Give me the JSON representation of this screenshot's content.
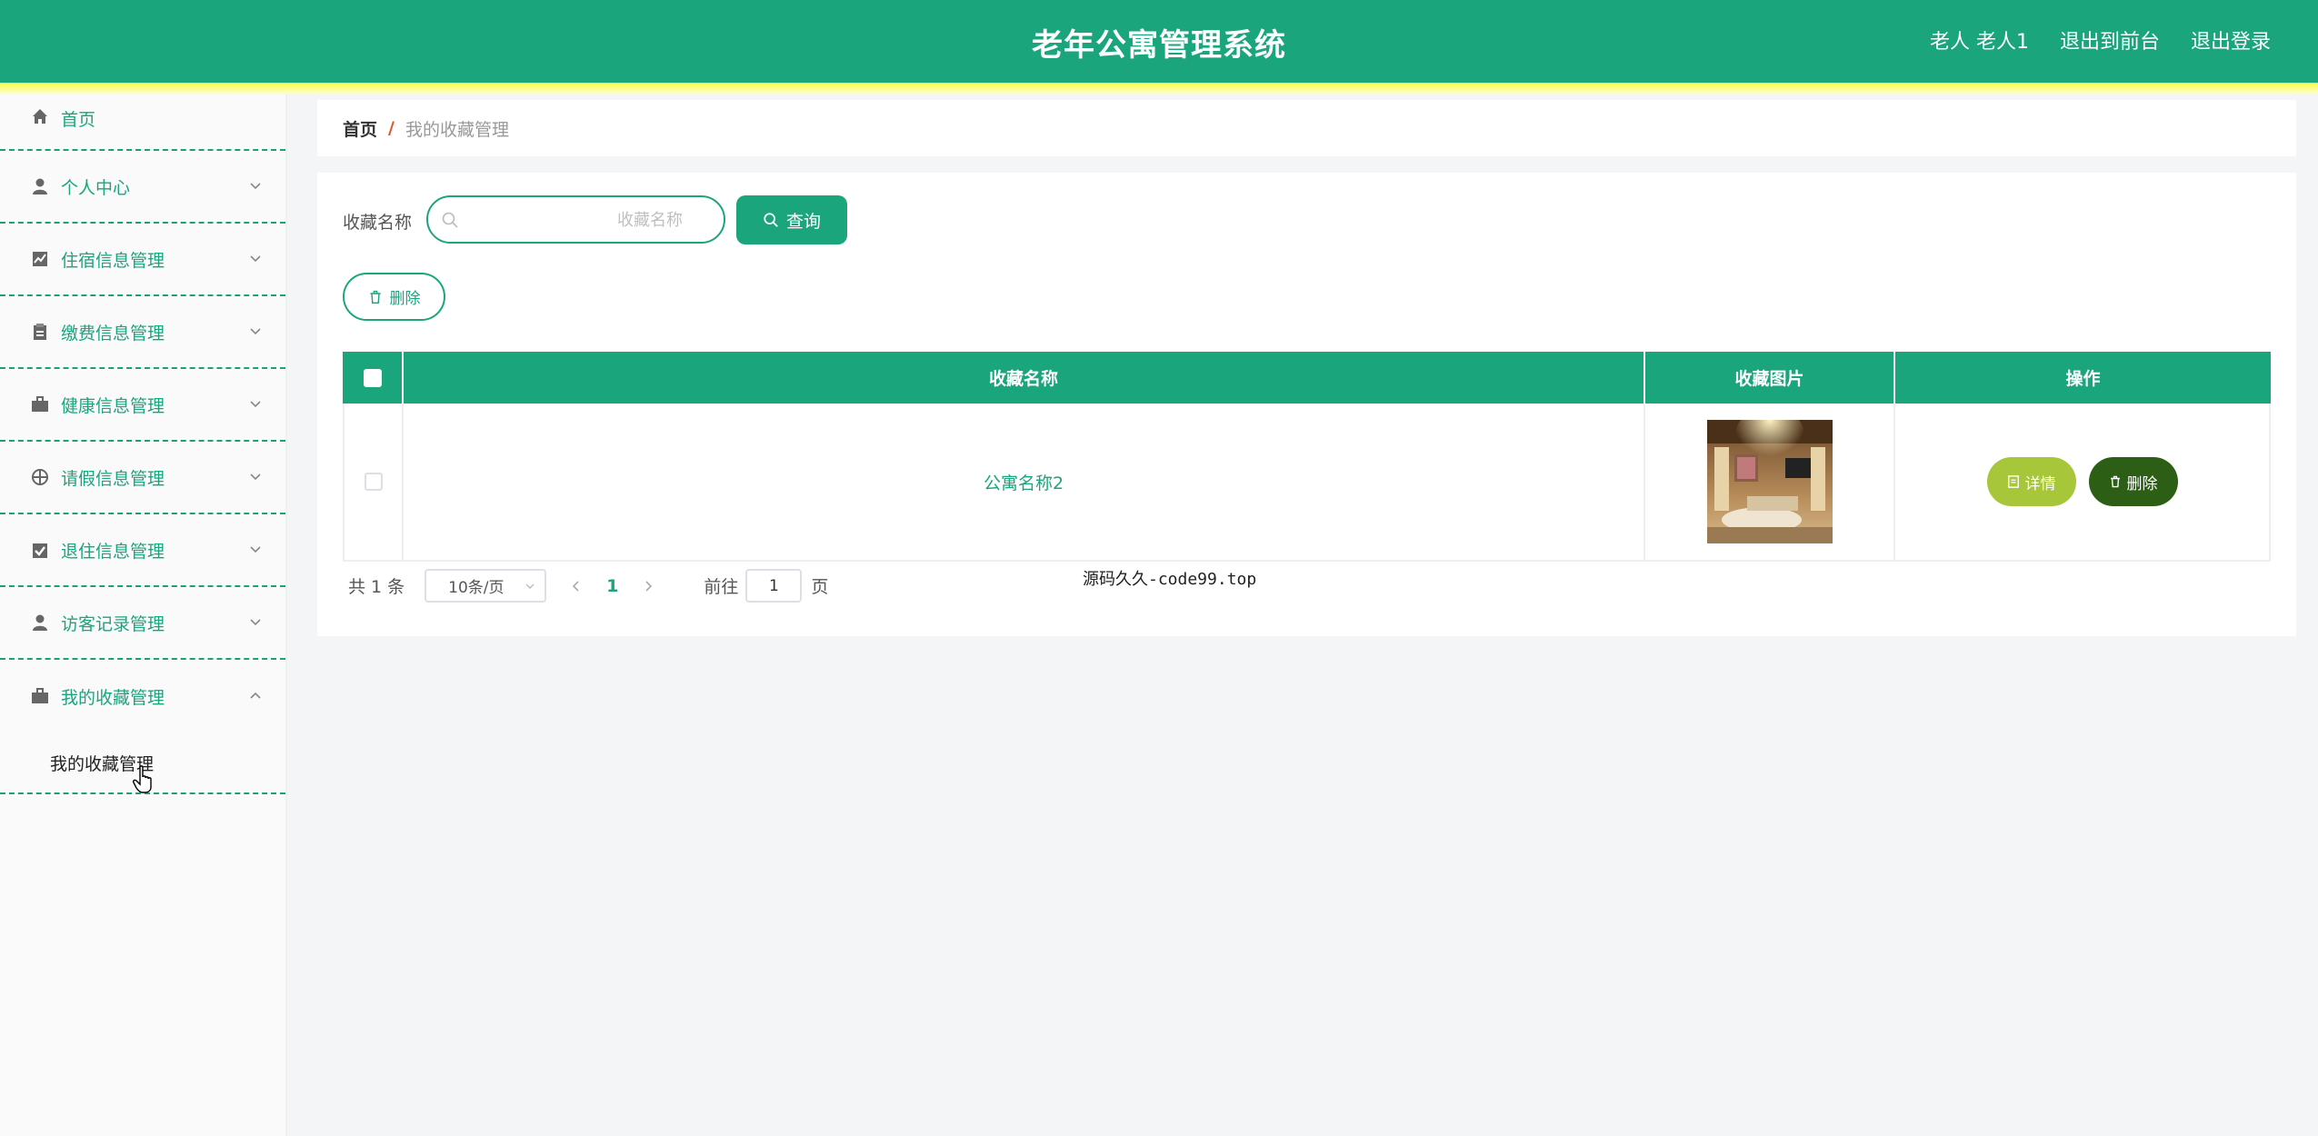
{
  "header": {
    "title": "老年公寓管理系统",
    "user_label": "老人 老人1",
    "links": [
      "退出到前台",
      "退出登录"
    ]
  },
  "sidebar": {
    "items": [
      {
        "label": "首页",
        "icon": "home-icon"
      },
      {
        "label": "个人中心",
        "icon": "user-icon"
      },
      {
        "label": "住宿信息管理",
        "icon": "chart-icon"
      },
      {
        "label": "缴费信息管理",
        "icon": "clipboard-icon"
      },
      {
        "label": "健康信息管理",
        "icon": "briefcase-icon"
      },
      {
        "label": "请假信息管理",
        "icon": "crosshair-icon"
      },
      {
        "label": "退住信息管理",
        "icon": "checklist-icon"
      },
      {
        "label": "访客记录管理",
        "icon": "user-icon"
      },
      {
        "label": "我的收藏管理",
        "icon": "briefcase-icon"
      }
    ],
    "sub_item": "我的收藏管理"
  },
  "breadcrumb": {
    "home": "首页",
    "separator": "/",
    "current": "我的收藏管理"
  },
  "search": {
    "label": "收藏名称",
    "placeholder": "收藏名称",
    "value": "",
    "button": "查询"
  },
  "toolbar": {
    "delete_label": "删除"
  },
  "table": {
    "columns": [
      "收藏名称",
      "收藏图片",
      "操作"
    ],
    "rows": [
      {
        "name": "公寓名称2",
        "image": "apartment-interior-photo",
        "detail_label": "详情",
        "delete_label": "删除"
      }
    ]
  },
  "pagination": {
    "total": "共 1 条",
    "page_size": "10条/页",
    "current_page": "1",
    "goto_label": "前往",
    "goto_value": "1",
    "suffix": "页"
  },
  "overlay_text": "源码久久-code99.top",
  "colors": {
    "primary": "#1aa57d",
    "detail": "#a7c63a",
    "delete": "#2d5e16",
    "stripe": "#f9fb45"
  }
}
